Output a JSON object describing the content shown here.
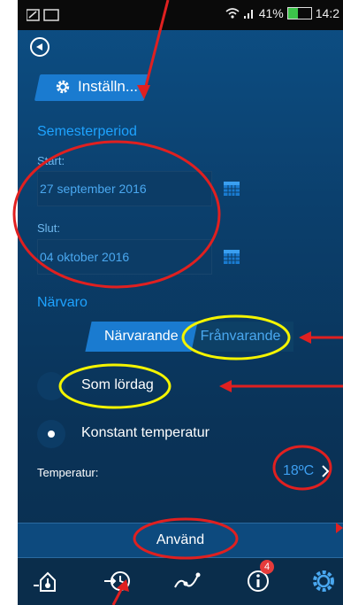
{
  "status_bar": {
    "battery": "41%",
    "time": "14:2"
  },
  "header": {
    "settings_tab_label": "Inställn..."
  },
  "vacation": {
    "section_title": "Semesterperiod",
    "start_label": "Start:",
    "start_value": "27 september 2016",
    "end_label": "Slut:",
    "end_value": "04 oktober 2016"
  },
  "presence": {
    "section_title": "Närvaro",
    "present_label": "Närvarande",
    "absent_label": "Frånvarande"
  },
  "modes": {
    "saturday_label": "Som lördag",
    "constant_label": "Konstant temperatur",
    "temperature_label": "Temperatur:",
    "temperature_value": "18ºC"
  },
  "apply_button": "Använd",
  "nav": {
    "info_badge": "4"
  },
  "colors": {
    "accent": "#1a7bd0",
    "label_blue": "#1ea3ff",
    "annotation_red": "#e02020",
    "annotation_yellow": "#f4f400"
  },
  "icons": [
    "back-icon",
    "gear-icon",
    "calendar-icon",
    "home-temp-icon",
    "clock-arrow-icon",
    "graph-icon",
    "info-icon"
  ]
}
